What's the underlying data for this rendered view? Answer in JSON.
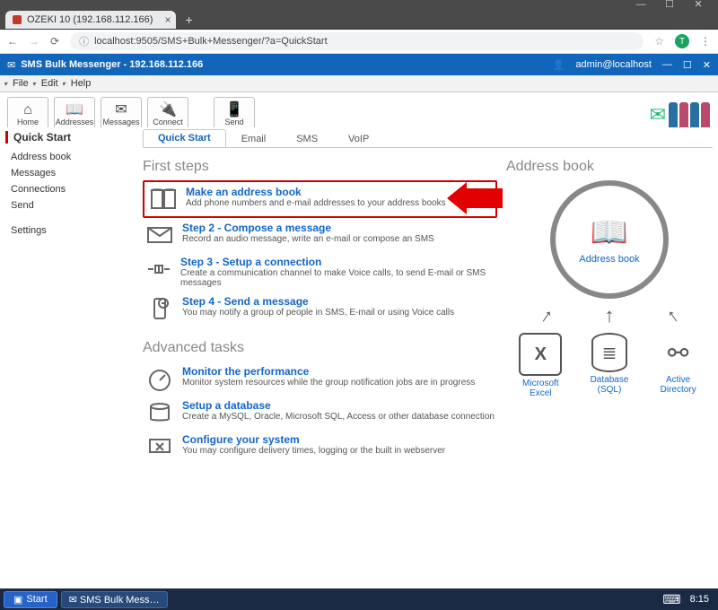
{
  "browser": {
    "tab_title": "OZEKI 10 (192.168.112.166)",
    "url": "localhost:9505/SMS+Bulk+Messenger/?a=QuickStart",
    "avatar_letter": "T",
    "win_min": "—",
    "win_max": "☐",
    "win_close": "✕"
  },
  "app": {
    "title": "SMS Bulk Messenger - 192.168.112.166",
    "user": "admin@localhost"
  },
  "menubar": {
    "file": "File",
    "edit": "Edit",
    "help": "Help"
  },
  "toolbar": {
    "home": "Home",
    "addresses": "Addresses",
    "messages": "Messages",
    "connect": "Connect",
    "send": "Send"
  },
  "sidebar": {
    "header": "Quick Start",
    "items": [
      "Address book",
      "Messages",
      "Connections",
      "Send",
      "Settings"
    ]
  },
  "tabs": [
    "Quick Start",
    "Email",
    "SMS",
    "VoIP"
  ],
  "sections": {
    "first_steps": "First steps",
    "advanced": "Advanced tasks",
    "address_book": "Address book"
  },
  "steps": [
    {
      "title": "Make an address book",
      "desc": "Add phone numbers and e-mail addresses to your address books"
    },
    {
      "title": "Step 2 - Compose a message",
      "desc": "Record an audio message, write an e-mail or compose an SMS"
    },
    {
      "title": "Step 3 - Setup a connection",
      "desc": "Create a communication channel to make Voice calls, to send E-mail or SMS messages"
    },
    {
      "title": "Step 4 - Send a message",
      "desc": "You may notify a group of people in SMS, E-mail or using Voice calls"
    }
  ],
  "adv": [
    {
      "title": "Monitor the performance",
      "desc": "Monitor system resources while the group notification jobs are in progress"
    },
    {
      "title": "Setup a database",
      "desc": "Create a MySQL, Oracle, Microsoft SQL, Access or other database connection"
    },
    {
      "title": "Configure your system",
      "desc": "You may configure delivery times, logging or the built in webserver"
    }
  ],
  "address_book_label": "Address book",
  "sources": [
    {
      "label": "Microsoft Excel",
      "glyph": "X"
    },
    {
      "label": "Database (SQL)",
      "glyph": "≣"
    },
    {
      "label": "Active Directory",
      "glyph": "⚯"
    }
  ],
  "taskbar": {
    "start": "Start",
    "task1": "SMS Bulk Mess…",
    "clock": "8:15"
  }
}
